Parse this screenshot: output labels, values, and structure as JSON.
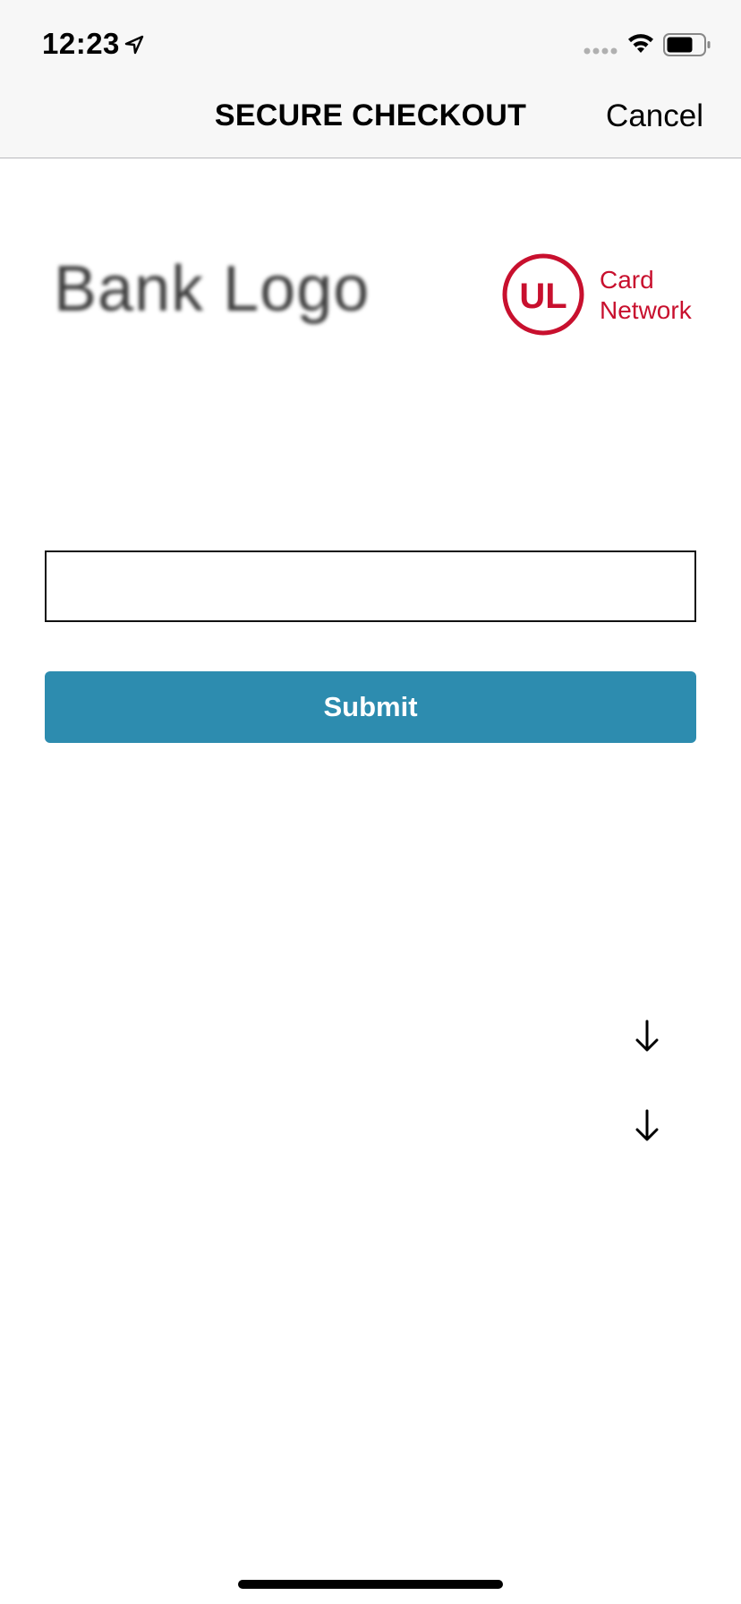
{
  "status_bar": {
    "time": "12:23",
    "location_icon": "location-arrow-icon",
    "signal_icon": "cellular-signal-icon",
    "wifi_icon": "wifi-icon",
    "battery_icon": "battery-icon"
  },
  "nav": {
    "title": "SECURE CHECKOUT",
    "cancel_label": "Cancel"
  },
  "logos": {
    "bank_logo_text": "Bank Logo",
    "network_mark": "UL",
    "network_line1": "Card",
    "network_line2": "Network"
  },
  "form": {
    "input_value": "",
    "input_placeholder": "",
    "submit_label": "Submit"
  },
  "expanders": [
    {
      "icon": "arrow-down-icon"
    },
    {
      "icon": "arrow-down-icon"
    }
  ],
  "colors": {
    "accent": "#2d8caf",
    "network_red": "#c8102e",
    "nav_background": "#f7f7f7"
  }
}
